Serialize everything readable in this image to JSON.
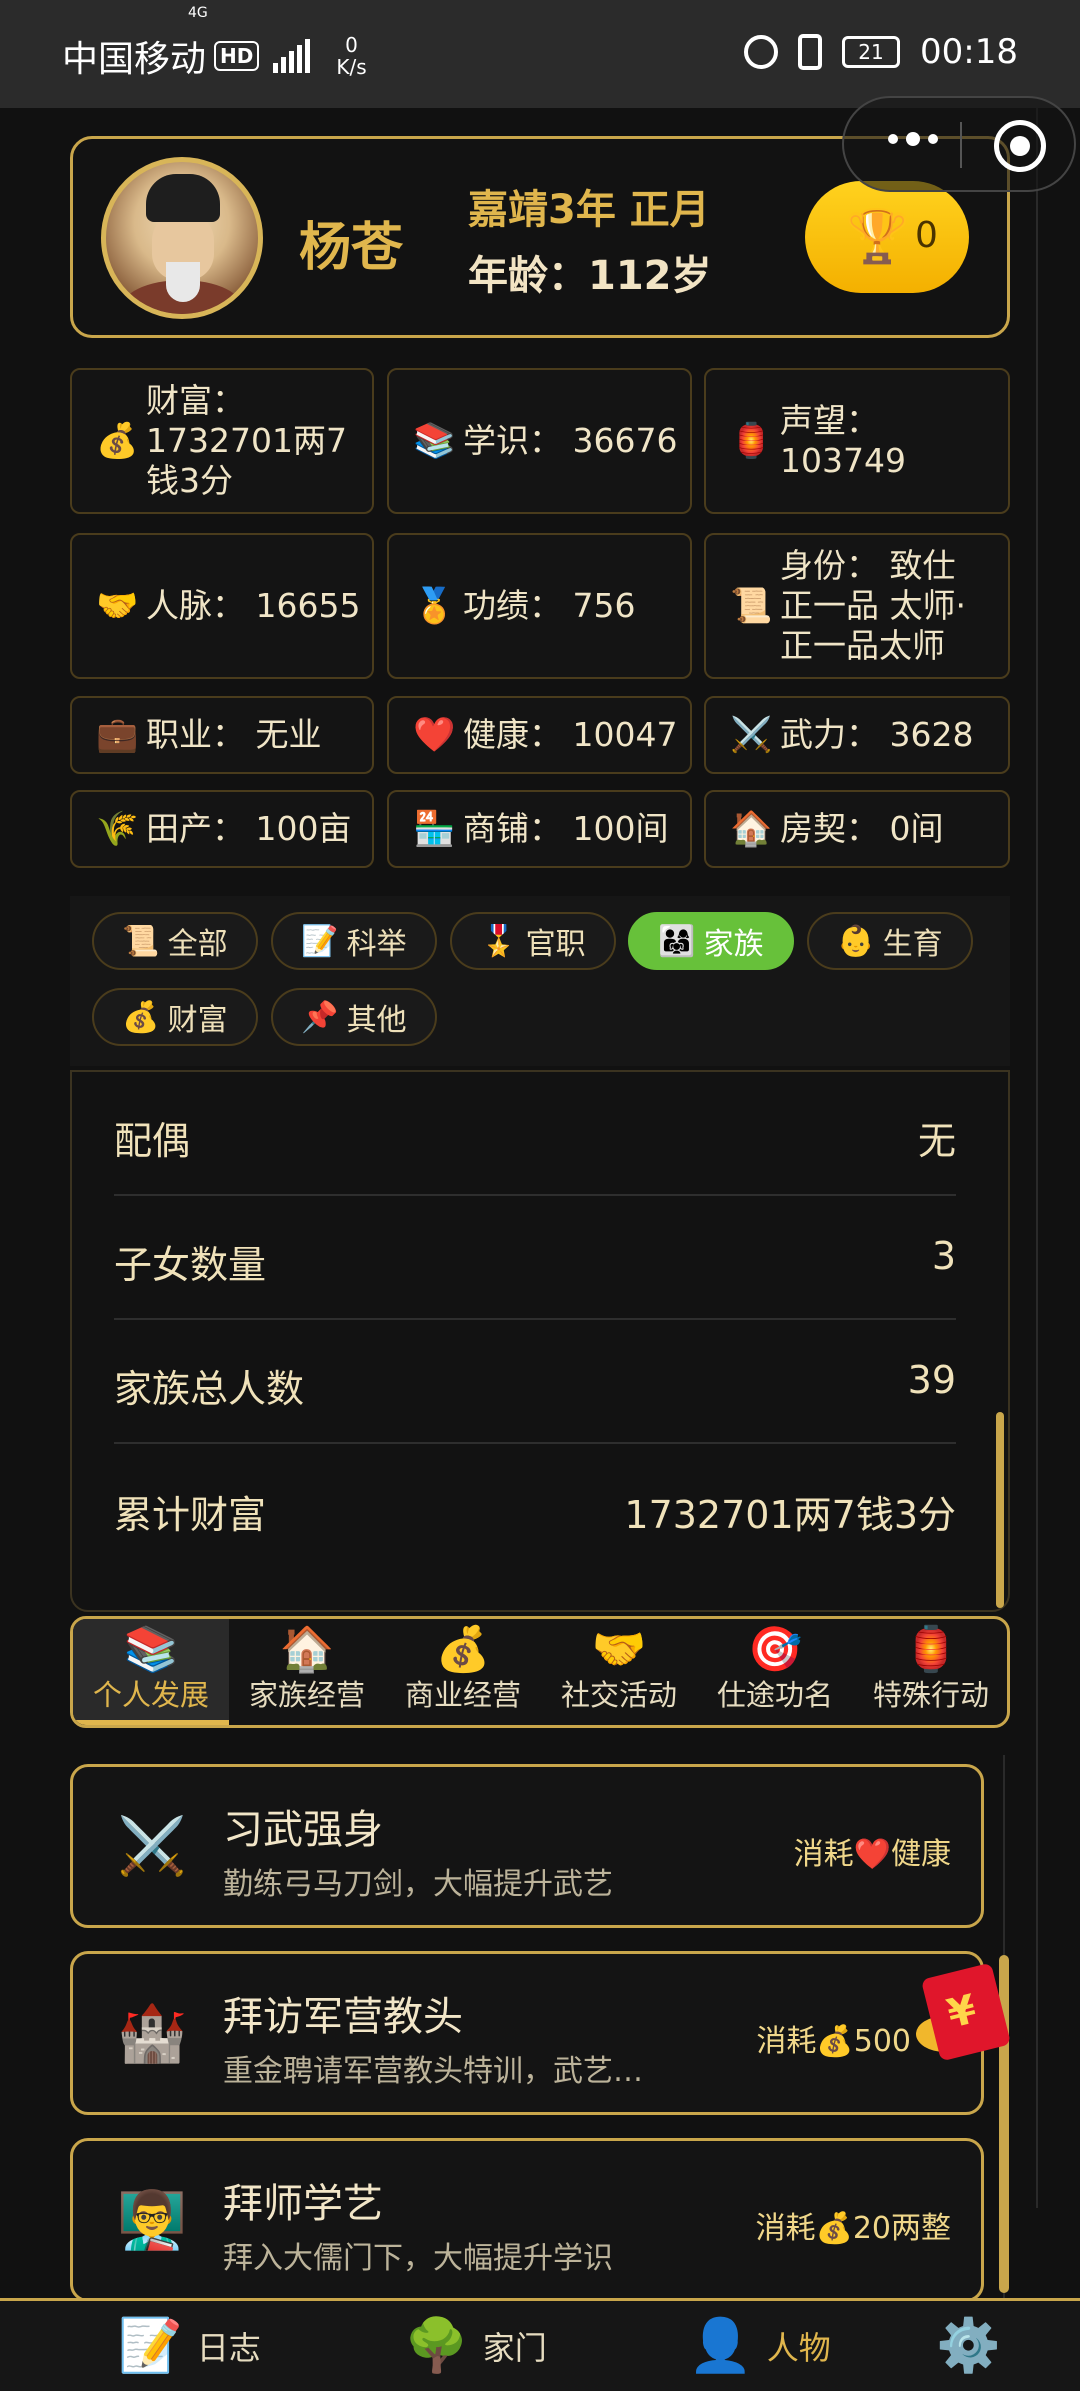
{
  "status_bar": {
    "carrier": "中国移动",
    "hd_badge": "HD",
    "network": "4G",
    "speed_value": "0",
    "speed_unit": "K/s",
    "battery": "21",
    "time": "00:18"
  },
  "profile": {
    "name": "杨苍",
    "date": "嘉靖3年 正月",
    "age": "年龄：112岁",
    "trophy_count": "0"
  },
  "stats": [
    {
      "icon": "💰",
      "icon_name": "money-bag-icon",
      "text": "财富： 1732701两7钱3分"
    },
    {
      "icon": "📚",
      "icon_name": "books-icon",
      "text": "学识： 36676"
    },
    {
      "icon": "🏮",
      "icon_name": "lantern-icon",
      "text": "声望： 103749"
    },
    {
      "icon": "🤝",
      "icon_name": "handshake-icon",
      "text": "人脉： 16655"
    },
    {
      "icon": "🏅",
      "icon_name": "medal-icon",
      "text": "功绩： 756"
    },
    {
      "icon": "📜",
      "icon_name": "scroll-icon",
      "text": "身份： 致仕 正一品 太师· 正一品太师"
    },
    {
      "icon": "💼",
      "icon_name": "briefcase-icon",
      "text": "职业： 无业"
    },
    {
      "icon": "❤️",
      "icon_name": "heart-icon",
      "text": "健康： 10047"
    },
    {
      "icon": "⚔️",
      "icon_name": "crossed-swords-icon",
      "text": "武力： 3628"
    },
    {
      "icon": "🌾",
      "icon_name": "grain-icon",
      "text": "田产： 100亩"
    },
    {
      "icon": "🏪",
      "icon_name": "shop-icon",
      "text": "商铺： 100间"
    },
    {
      "icon": "🏠",
      "icon_name": "house-icon",
      "text": "房契： 0间"
    }
  ],
  "filters": [
    {
      "icon": "📜",
      "icon_name": "scroll-icon",
      "label": "全部"
    },
    {
      "icon": "📝",
      "icon_name": "memo-icon",
      "label": "科举"
    },
    {
      "icon": "🎖️",
      "icon_name": "military-medal-icon",
      "label": "官职"
    },
    {
      "icon": "👨‍👩‍👧",
      "icon_name": "family-icon",
      "label": "家族",
      "active": true
    },
    {
      "icon": "👶",
      "icon_name": "baby-icon",
      "label": "生育"
    },
    {
      "icon": "💰",
      "icon_name": "money-bag-icon",
      "label": "财富"
    },
    {
      "icon": "📌",
      "icon_name": "pushpin-icon",
      "label": "其他"
    }
  ],
  "family_info": [
    {
      "label": "配偶",
      "value": "无"
    },
    {
      "label": "子女数量",
      "value": "3"
    },
    {
      "label": "家族总人数",
      "value": "39"
    },
    {
      "label": "累计财富",
      "value": "1732701两7钱3分"
    }
  ],
  "category_tabs": [
    {
      "icon": "📚",
      "icon_name": "books-icon",
      "label": "个人发展",
      "active": true
    },
    {
      "icon": "🏠",
      "icon_name": "house-icon",
      "label": "家族经营"
    },
    {
      "icon": "💰",
      "icon_name": "money-bag-icon",
      "label": "商业经营"
    },
    {
      "icon": "🤝",
      "icon_name": "handshake-icon",
      "label": "社交活动"
    },
    {
      "icon": "🎯",
      "icon_name": "target-icon",
      "label": "仕途功名"
    },
    {
      "icon": "🏮",
      "icon_name": "lantern-icon",
      "label": "特殊行动"
    }
  ],
  "actions": [
    {
      "icon": "⚔️",
      "icon_name": "crossed-swords-icon",
      "title": "习武强身",
      "desc": "勤练弓马刀剑，大幅提升武艺",
      "cost": "消耗❤️健康"
    },
    {
      "icon": "🏰",
      "icon_name": "castle-icon",
      "title": "拜访军营教头",
      "desc": "重金聘请军营教头特训，武艺…",
      "cost": "消耗💰500"
    },
    {
      "icon": "👨‍🏫",
      "icon_name": "teacher-icon",
      "title": "拜师学艺",
      "desc": "拜入大儒门下，大幅提升学识",
      "cost": "消耗💰20两整"
    }
  ],
  "red_packet": {
    "symbol": "¥"
  },
  "bottom_nav": [
    {
      "icon": "📝",
      "icon_name": "journal-icon",
      "label": "日志"
    },
    {
      "icon": "🌳",
      "icon_name": "tree-icon",
      "label": "家门"
    },
    {
      "icon": "👤",
      "icon_name": "person-icon",
      "label": "人物",
      "active": true
    },
    {
      "icon": "⚙️",
      "icon_name": "gear-icon",
      "label": ""
    }
  ]
}
